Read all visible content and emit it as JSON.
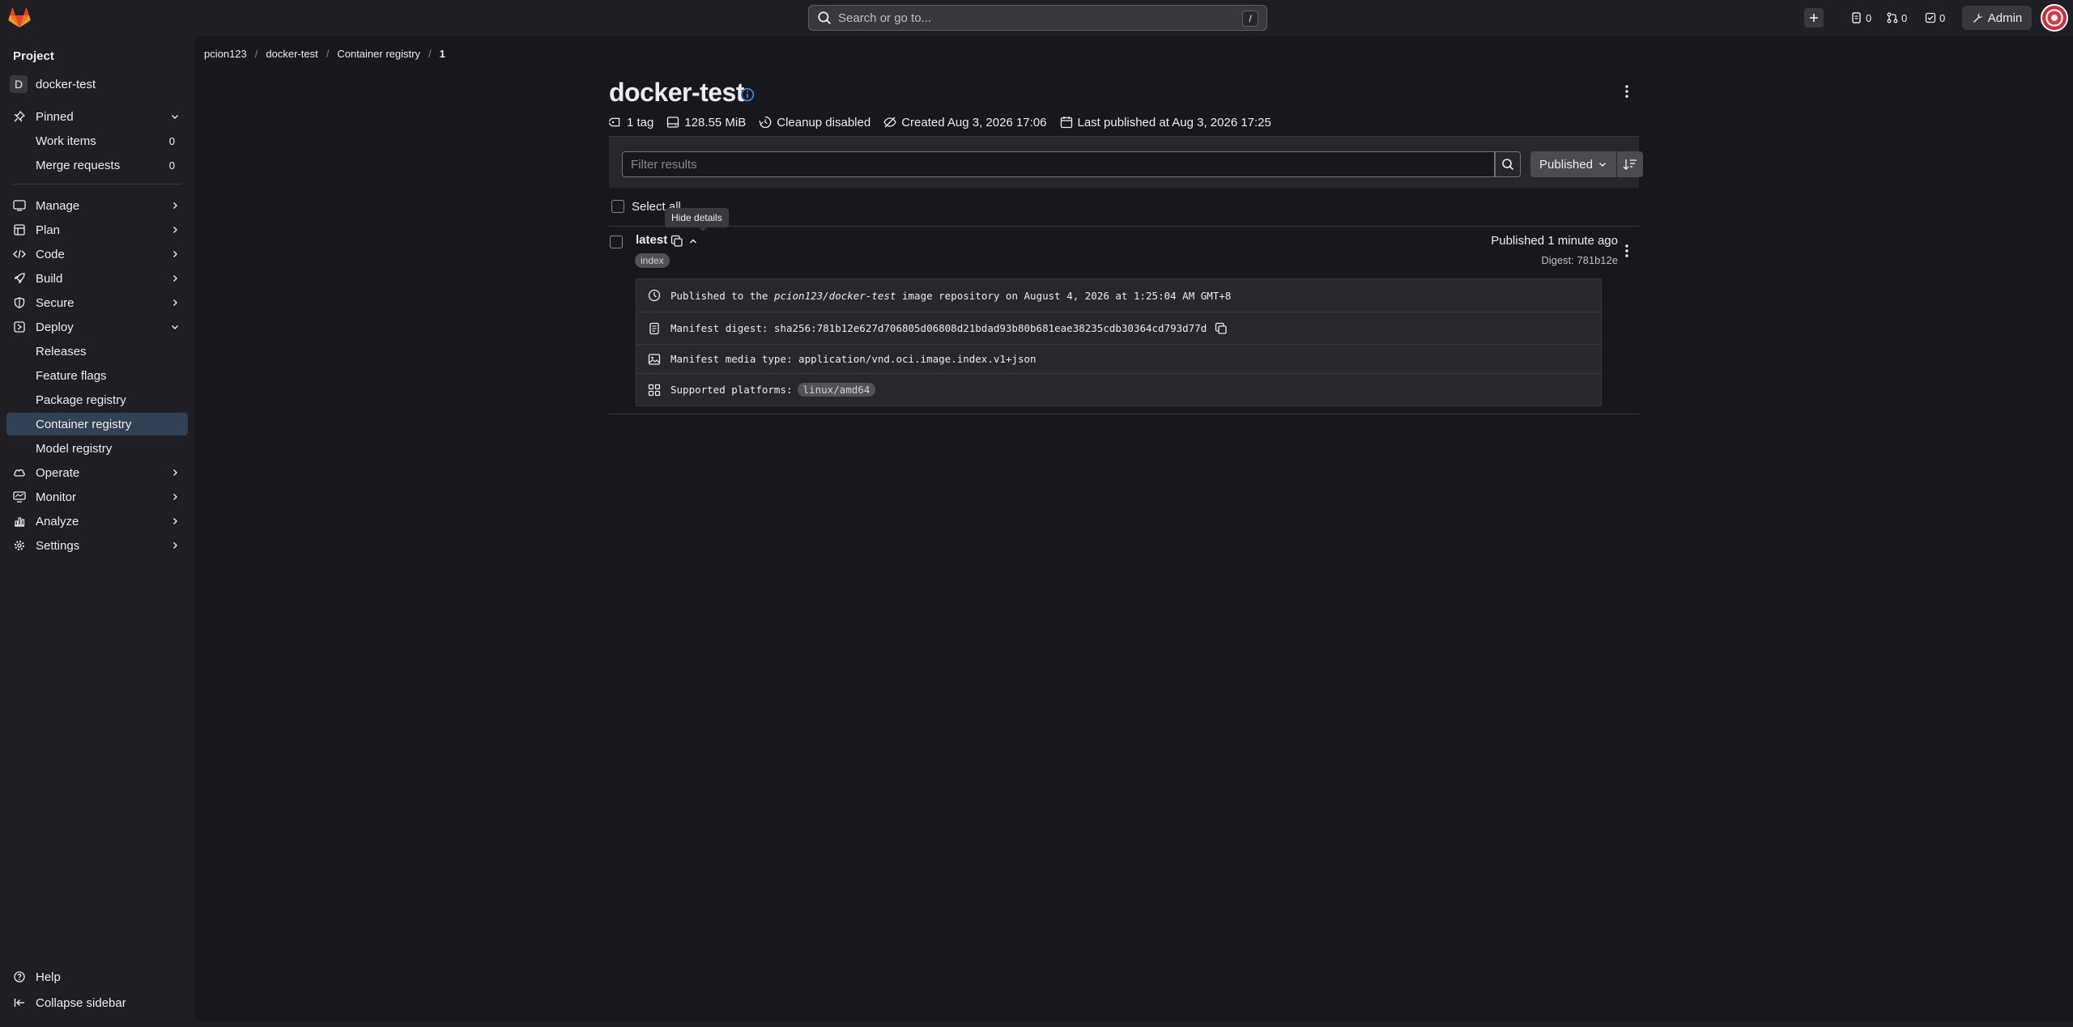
{
  "topbar": {
    "search_placeholder": "Search or go to...",
    "search_shortcut": "/",
    "issues_count": "0",
    "merge_requests_count": "0",
    "todos_count": "0",
    "admin_label": "Admin"
  },
  "sidebar": {
    "section_title": "Project",
    "project_initial": "D",
    "project_name": "docker-test",
    "pinned": {
      "label": "Pinned",
      "items": [
        {
          "label": "Work items",
          "count": "0"
        },
        {
          "label": "Merge requests",
          "count": "0"
        }
      ]
    },
    "groups": [
      {
        "label": "Manage",
        "icon": "users-icon"
      },
      {
        "label": "Plan",
        "icon": "planning-icon"
      },
      {
        "label": "Code",
        "icon": "code-icon"
      },
      {
        "label": "Build",
        "icon": "rocket-icon"
      },
      {
        "label": "Secure",
        "icon": "shield-icon"
      },
      {
        "label": "Deploy",
        "icon": "deployments-icon"
      }
    ],
    "deploy_items": [
      "Releases",
      "Feature flags",
      "Package registry",
      "Container registry",
      "Model registry"
    ],
    "groups_after": [
      {
        "label": "Operate",
        "icon": "cloud-icon"
      },
      {
        "label": "Monitor",
        "icon": "monitor-icon"
      },
      {
        "label": "Analyze",
        "icon": "chart-icon"
      },
      {
        "label": "Settings",
        "icon": "gear-icon"
      }
    ],
    "help_label": "Help",
    "collapse_label": "Collapse sidebar"
  },
  "breadcrumb": [
    "pcion123",
    "docker-test",
    "Container registry",
    "1"
  ],
  "image": {
    "name": "docker-test",
    "tag_count": "1 tag",
    "size": "128.55 MiB",
    "cleanup": "Cleanup disabled",
    "created": "Created Aug 3, 2026 17:06",
    "last_published": "Last published at Aug 3, 2026 17:25"
  },
  "filter": {
    "placeholder": "Filter results",
    "sort_label": "Published"
  },
  "list": {
    "select_all_label": "Select all",
    "tooltip": "Hide details"
  },
  "tag": {
    "name": "latest",
    "badge": "index",
    "published": "Published 1 minute ago",
    "digest_short": "Digest: 781b12e",
    "details": {
      "published_prefix": "Published to the",
      "repo_path": "pcion123/docker-test",
      "published_suffix": "image repository on August 4, 2026 at 1:25:04 AM GMT+8",
      "manifest_digest": "Manifest digest: sha256:781b12e627d706805d06808d21bdad93b80b681eae38235cdb30364cd793d77d",
      "media_type": "Manifest media type: application/vnd.oci.image.index.v1+json",
      "platforms_label": "Supported platforms:",
      "platform": "linux/amd64"
    }
  },
  "colors": {
    "accent": "#1f75cb",
    "active_item": "#334155",
    "brand_orange": "#fc6d26"
  }
}
